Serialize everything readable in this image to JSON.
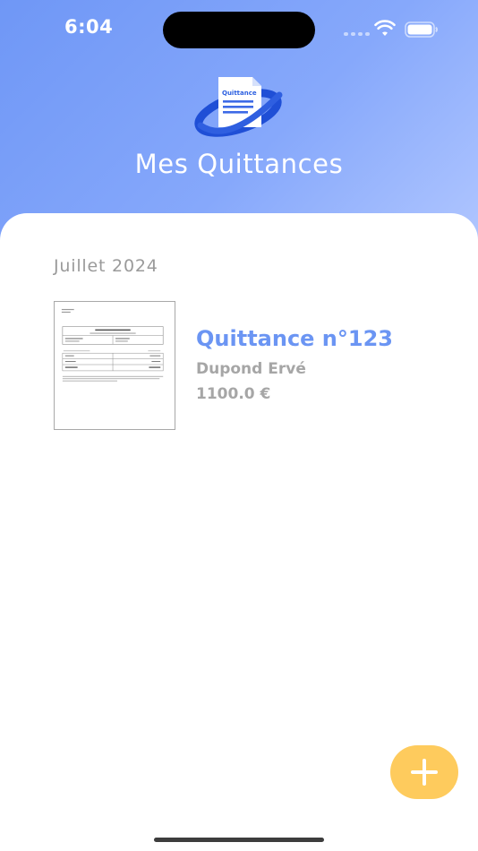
{
  "status_bar": {
    "time": "6:04",
    "icons": [
      "cellular-icon",
      "wifi-icon",
      "battery-icon"
    ]
  },
  "header": {
    "title": "Mes Quittances",
    "logo_label": "Quittance",
    "logo_icon": "document-icon"
  },
  "sections": [
    {
      "header": "Juillet 2024",
      "items": [
        {
          "title": "Quittance n°123",
          "tenant": "Dupond Ervé",
          "amount": "1100.0 €"
        }
      ]
    }
  ],
  "fab": {
    "icon": "plus-icon"
  },
  "colors": {
    "header_gradient_start": "#6f97f6",
    "header_gradient_end": "#b3c8ff",
    "accent_blue": "#6b95f3",
    "secondary_text": "#a6a6a6",
    "fab": "#fecb5d"
  }
}
